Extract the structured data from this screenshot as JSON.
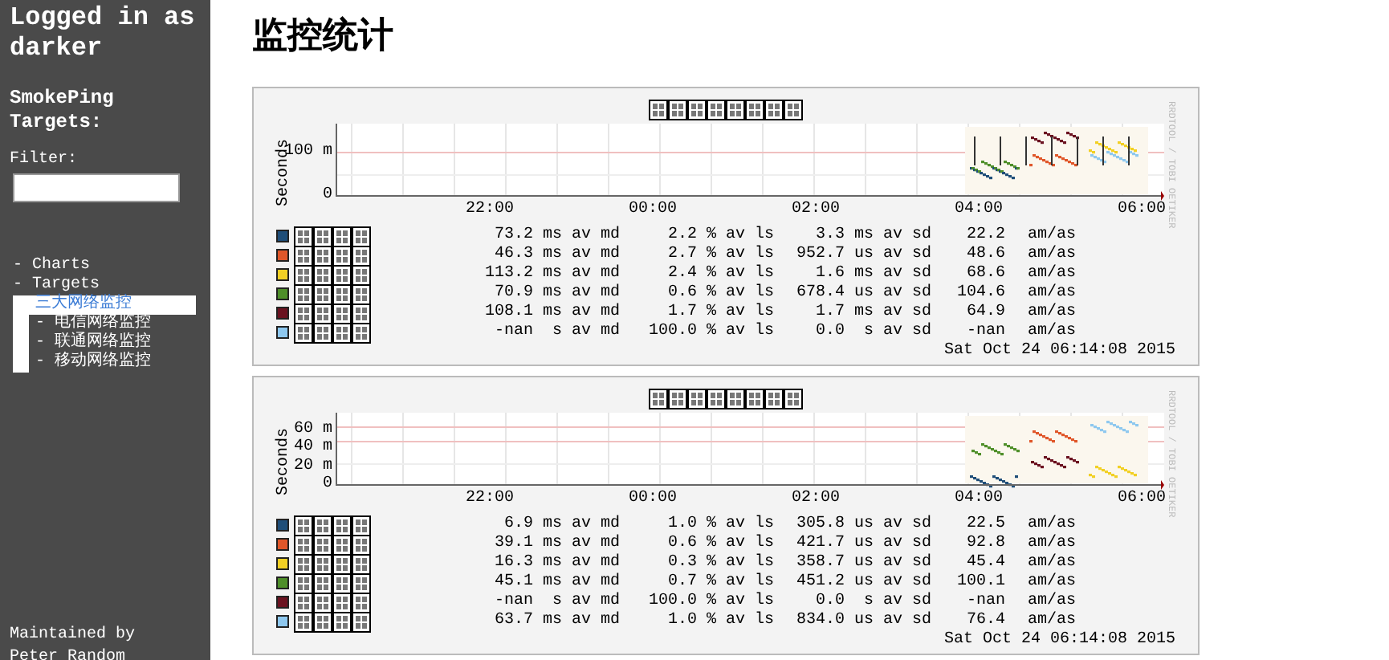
{
  "sidebar": {
    "login": "Logged in as darker",
    "targets_heading": "SmokePing Targets:",
    "filter": {
      "label": "Filter:"
    },
    "tree": [
      {
        "label": "- Charts",
        "selected": false
      },
      {
        "label": "- Targets",
        "selected": false,
        "children": [
          {
            "label": "三大网络监控",
            "selected": true
          },
          {
            "label": "- 电信网络监控",
            "selected": false
          },
          {
            "label": "- 联通网络监控",
            "selected": false
          },
          {
            "label": "- 移动网络监控",
            "selected": false
          }
        ]
      }
    ],
    "footer": "Maintained by Peter Random"
  },
  "page": {
    "title": "监控统计"
  },
  "graphs": [
    {
      "ylabel": "Seconds",
      "side_text": "RRDTOOL / TOBI OETIKER",
      "y_ticks": [
        "100 m",
        "0"
      ],
      "x_ticks": [
        "22:00",
        "00:00",
        "02:00",
        "04:00",
        "06:00"
      ],
      "legend": [
        {
          "color": "#1f4e79",
          "median": "73.2 ms av md",
          "loss": "2.2 % av ls",
          "sd": "3.3 ms av sd",
          "amas": "22.2",
          "unit": "am/as"
        },
        {
          "color": "#e0572a",
          "median": "46.3 ms av md",
          "loss": "2.7 % av ls",
          "sd": "952.7 us av sd",
          "amas": "48.6",
          "unit": "am/as"
        },
        {
          "color": "#f2d024",
          "median": "113.2 ms av md",
          "loss": "2.4 % av ls",
          "sd": "1.6 ms av sd",
          "amas": "68.6",
          "unit": "am/as"
        },
        {
          "color": "#4f8f2a",
          "median": "70.9 ms av md",
          "loss": "0.6 % av ls",
          "sd": "678.4 us av sd",
          "amas": "104.6",
          "unit": "am/as"
        },
        {
          "color": "#6b1220",
          "median": "108.1 ms av md",
          "loss": "1.7 % av ls",
          "sd": "1.7 ms av sd",
          "amas": "64.9",
          "unit": "am/as"
        },
        {
          "color": "#8ec8ef",
          "median": "-nan  s av md",
          "loss": "100.0 % av ls",
          "sd": "0.0  s av sd",
          "amas": "-nan",
          "unit": "am/as"
        }
      ],
      "timestamp": "Sat Oct 24 06:14:08 2015"
    },
    {
      "ylabel": "Seconds",
      "side_text": "RRDTOOL / TOBI OETIKER",
      "y_ticks": [
        "60 m",
        "40 m",
        "20 m",
        "0"
      ],
      "x_ticks": [
        "22:00",
        "00:00",
        "02:00",
        "04:00",
        "06:00"
      ],
      "legend": [
        {
          "color": "#1f4e79",
          "median": "6.9 ms av md",
          "loss": "1.0 % av ls",
          "sd": "305.8 us av sd",
          "amas": "22.5",
          "unit": "am/as"
        },
        {
          "color": "#e0572a",
          "median": "39.1 ms av md",
          "loss": "0.6 % av ls",
          "sd": "421.7 us av sd",
          "amas": "92.8",
          "unit": "am/as"
        },
        {
          "color": "#f2d024",
          "median": "16.3 ms av md",
          "loss": "0.3 % av ls",
          "sd": "358.7 us av sd",
          "amas": "45.4",
          "unit": "am/as"
        },
        {
          "color": "#4f8f2a",
          "median": "45.1 ms av md",
          "loss": "0.7 % av ls",
          "sd": "451.2 us av sd",
          "amas": "100.1",
          "unit": "am/as"
        },
        {
          "color": "#6b1220",
          "median": "-nan  s av md",
          "loss": "100.0 % av ls",
          "sd": "0.0  s av sd",
          "amas": "-nan",
          "unit": "am/as"
        },
        {
          "color": "#8ec8ef",
          "median": "63.7 ms av md",
          "loss": "1.0 % av ls",
          "sd": "834.0 us av sd",
          "amas": "76.4",
          "unit": "am/as"
        }
      ],
      "timestamp": "Sat Oct 24 06:14:08 2015"
    }
  ]
}
